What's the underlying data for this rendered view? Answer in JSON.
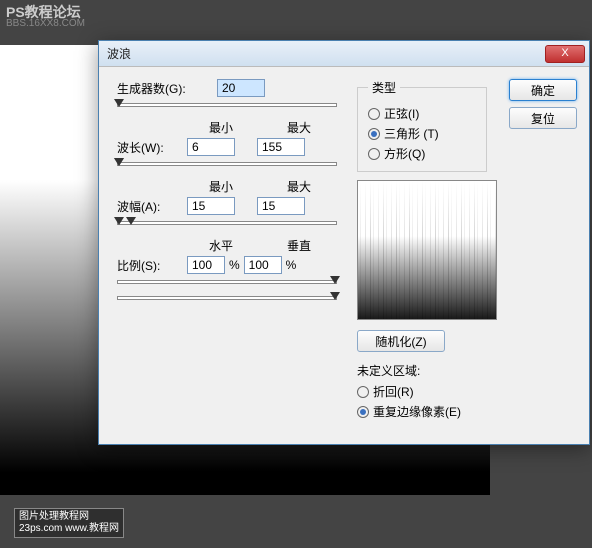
{
  "watermark": {
    "line1": "PS教程论坛",
    "line2": "BBS.16XX8.COM",
    "bottom1": "图片处理教程网",
    "bottom2": "23ps.com www.教程网"
  },
  "dialog": {
    "title": "波浪",
    "close": "X",
    "generators_label": "生成器数(G):",
    "generators_value": "20",
    "min_label": "最小",
    "max_label": "最大",
    "wavelength_label": "波长(W):",
    "wavelength_min": "6",
    "wavelength_max": "155",
    "amplitude_label": "波幅(A):",
    "amplitude_min": "15",
    "amplitude_max": "15",
    "horiz_label": "水平",
    "vert_label": "垂直",
    "scale_label": "比例(S):",
    "scale_h": "100",
    "scale_v": "100",
    "percent": "%",
    "type_legend": "类型",
    "type_sine": "正弦(I)",
    "type_triangle": "三角形 (T)",
    "type_square": "方形(Q)",
    "ok": "确定",
    "reset": "复位",
    "randomize": "随机化(Z)",
    "undef_legend": "未定义区域:",
    "undef_wrap": "折回(R)",
    "undef_repeat": "重复边缘像素(E)"
  }
}
